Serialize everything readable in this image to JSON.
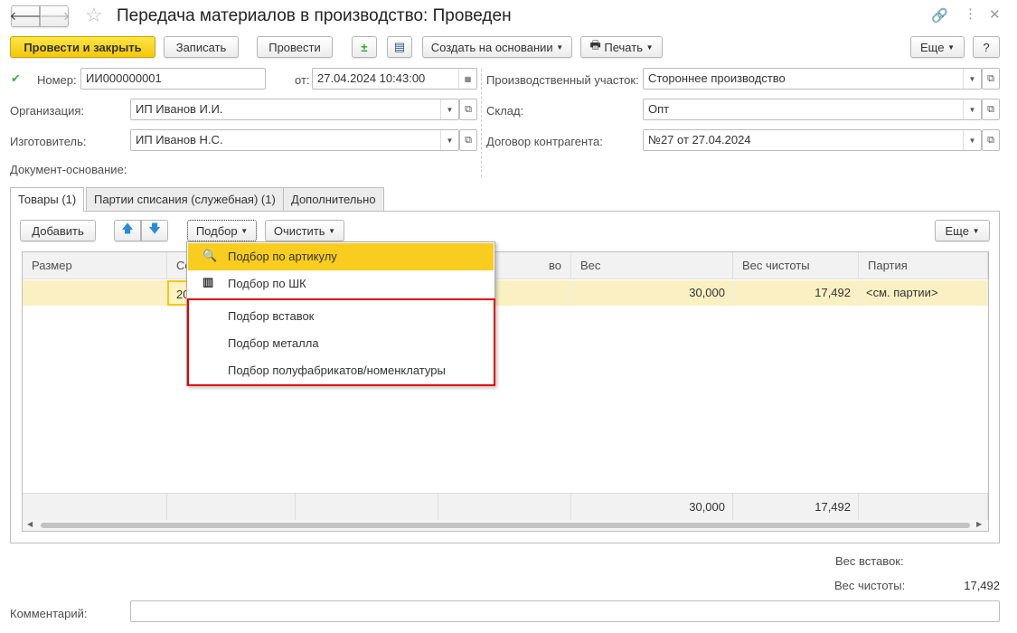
{
  "window": {
    "title": "Передача материалов в производство: Проведен"
  },
  "toolbar": {
    "post_close": "Провести и закрыть",
    "save": "Записать",
    "post": "Провести",
    "create_based": "Создать на основании",
    "print": "Печать",
    "more": "Еще",
    "help": "?"
  },
  "header": {
    "number_label": "Номер:",
    "number": "ИИ000000001",
    "date_label": "от:",
    "date": "27.04.2024 10:43:00",
    "org_label": "Организация:",
    "org": "ИП Иванов И.И.",
    "maker_label": "Изготовитель:",
    "maker": "ИП Иванов Н.С.",
    "basis_label": "Документ-основание:",
    "site_label": "Производственный участок:",
    "site": "Стороннее производство",
    "warehouse_label": "Склад:",
    "warehouse": "Опт",
    "contract_label": "Договор контрагента:",
    "contract": "№27 от 27.04.2024"
  },
  "tabs": [
    "Товары (1)",
    "Партии списания (служебная) (1)",
    "Дополнительно"
  ],
  "table_toolbar": {
    "add": "Добавить",
    "pick": "Подбор",
    "clear": "Очистить",
    "more": "Еще"
  },
  "table": {
    "columns": [
      "Размер",
      "Се",
      "",
      "во",
      "Вес",
      "Вес чистоты",
      "Партия"
    ],
    "row": [
      "",
      "20",
      "",
      "",
      "30,000",
      "17,492",
      "<см. партии>"
    ],
    "footer": [
      "",
      "",
      "",
      "",
      "30,000",
      "17,492",
      ""
    ]
  },
  "menu": {
    "items": [
      "Подбор по артикулу",
      "Подбор по ШК",
      "Подбор вставок",
      "Подбор металла",
      "Подбор полуфабрикатов/номенклатуры"
    ],
    "highlight_color": "#f9cd1f",
    "frame_color": "#e60000"
  },
  "totals": {
    "inserts_label": "Вес вставок:",
    "inserts": "",
    "purity_label": "Вес чистоты:",
    "purity": "17,492"
  },
  "comment": {
    "label": "Комментарий:",
    "value": ""
  }
}
